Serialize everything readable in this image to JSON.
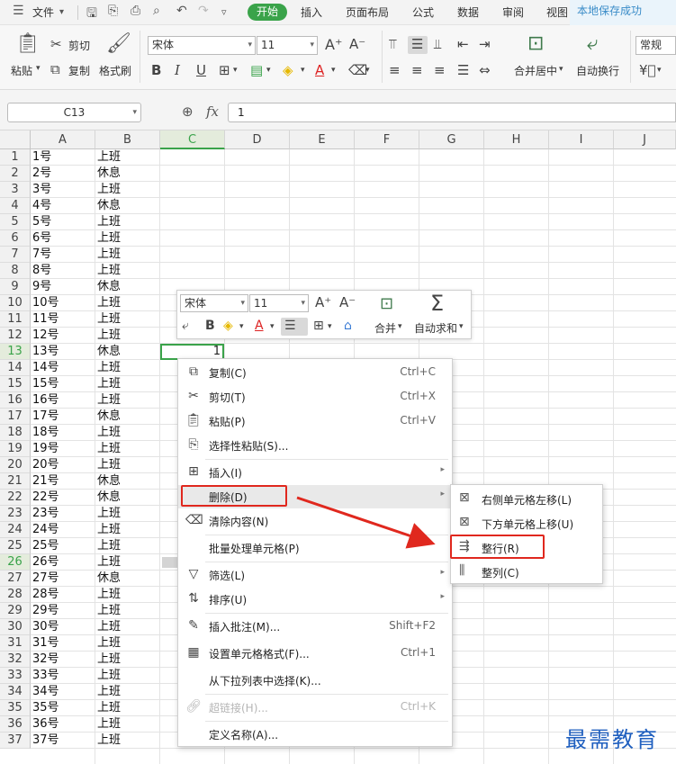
{
  "menubar": {
    "file": "文件",
    "start": "开始",
    "tabs": [
      "插入",
      "页面布局",
      "公式",
      "数据",
      "审阅",
      "视图"
    ],
    "save_status": "本地保存成功"
  },
  "ribbon": {
    "paste": "粘贴",
    "cut": "剪切",
    "copy": "复制",
    "format_painter": "格式刷",
    "font_name": "宋体",
    "font_size": "11",
    "merge_center": "合并居中",
    "wrap_text": "自动换行",
    "number_format": "常规"
  },
  "formula_bar": {
    "name_box": "C13",
    "fx": "fx",
    "value": "1"
  },
  "columns": [
    "A",
    "B",
    "C",
    "D",
    "E",
    "F",
    "G",
    "H",
    "I",
    "J"
  ],
  "rows": [
    {
      "n": "1",
      "a": "1号",
      "b": "上班"
    },
    {
      "n": "2",
      "a": "2号",
      "b": "休息"
    },
    {
      "n": "3",
      "a": "3号",
      "b": "上班"
    },
    {
      "n": "4",
      "a": "4号",
      "b": "休息"
    },
    {
      "n": "5",
      "a": "5号",
      "b": "上班"
    },
    {
      "n": "6",
      "a": "6号",
      "b": "上班"
    },
    {
      "n": "7",
      "a": "7号",
      "b": "上班"
    },
    {
      "n": "8",
      "a": "8号",
      "b": "上班"
    },
    {
      "n": "9",
      "a": "9号",
      "b": "休息"
    },
    {
      "n": "10",
      "a": "10号",
      "b": "上班"
    },
    {
      "n": "11",
      "a": "11号",
      "b": "上班"
    },
    {
      "n": "12",
      "a": "12号",
      "b": "上班"
    },
    {
      "n": "13",
      "a": "13号",
      "b": "休息"
    },
    {
      "n": "14",
      "a": "14号",
      "b": "上班"
    },
    {
      "n": "15",
      "a": "15号",
      "b": "上班"
    },
    {
      "n": "16",
      "a": "16号",
      "b": "上班"
    },
    {
      "n": "17",
      "a": "17号",
      "b": "休息"
    },
    {
      "n": "18",
      "a": "18号",
      "b": "上班"
    },
    {
      "n": "19",
      "a": "19号",
      "b": "上班"
    },
    {
      "n": "20",
      "a": "20号",
      "b": "上班"
    },
    {
      "n": "21",
      "a": "21号",
      "b": "休息"
    },
    {
      "n": "22",
      "a": "22号",
      "b": "休息"
    },
    {
      "n": "23",
      "a": "23号",
      "b": "上班"
    },
    {
      "n": "24",
      "a": "24号",
      "b": "上班"
    },
    {
      "n": "25",
      "a": "25号",
      "b": "上班"
    },
    {
      "n": "26",
      "a": "26号",
      "b": "上班"
    },
    {
      "n": "27",
      "a": "27号",
      "b": "休息"
    },
    {
      "n": "28",
      "a": "28号",
      "b": "上班"
    },
    {
      "n": "29",
      "a": "29号",
      "b": "上班"
    },
    {
      "n": "30",
      "a": "30号",
      "b": "上班"
    },
    {
      "n": "31",
      "a": "31号",
      "b": "上班"
    },
    {
      "n": "32",
      "a": "32号",
      "b": "上班"
    },
    {
      "n": "33",
      "a": "33号",
      "b": "上班"
    },
    {
      "n": "34",
      "a": "34号",
      "b": "上班"
    },
    {
      "n": "35",
      "a": "35号",
      "b": "上班"
    },
    {
      "n": "36",
      "a": "36号",
      "b": "上班"
    },
    {
      "n": "37",
      "a": "37号",
      "b": "上班"
    }
  ],
  "active_cell_value": "1",
  "minibar": {
    "font_name": "宋体",
    "font_size": "11",
    "merge": "合并",
    "autosum": "自动求和"
  },
  "context_menu": {
    "items": [
      {
        "label": "复制(C)",
        "shortcut": "Ctrl+C",
        "icon": "copy-icon"
      },
      {
        "label": "剪切(T)",
        "shortcut": "Ctrl+X",
        "icon": "scissors-icon"
      },
      {
        "label": "粘贴(P)",
        "shortcut": "Ctrl+V",
        "icon": "paste-icon"
      },
      {
        "label": "选择性粘贴(S)...",
        "shortcut": "",
        "icon": "paste-special-icon"
      },
      {
        "label": "插入(I)",
        "shortcut": "",
        "icon": "insert-icon"
      },
      {
        "label": "删除(D)",
        "shortcut": "",
        "icon": ""
      },
      {
        "label": "清除内容(N)",
        "shortcut": "",
        "icon": "eraser-icon"
      },
      {
        "label": "批量处理单元格(P)",
        "shortcut": "",
        "icon": ""
      },
      {
        "label": "筛选(L)",
        "shortcut": "",
        "icon": "filter-icon"
      },
      {
        "label": "排序(U)",
        "shortcut": "",
        "icon": "sort-icon"
      },
      {
        "label": "插入批注(M)...",
        "shortcut": "Shift+F2",
        "icon": "comment-icon"
      },
      {
        "label": "设置单元格格式(F)...",
        "shortcut": "Ctrl+1",
        "icon": "format-cells-icon"
      },
      {
        "label": "从下拉列表中选择(K)...",
        "shortcut": "",
        "icon": ""
      },
      {
        "label": "超链接(H)...",
        "shortcut": "Ctrl+K",
        "icon": "link-icon"
      },
      {
        "label": "定义名称(A)...",
        "shortcut": "",
        "icon": ""
      }
    ]
  },
  "submenu": {
    "items": [
      {
        "label": "右侧单元格左移(L)",
        "icon": "shift-left-icon"
      },
      {
        "label": "下方单元格上移(U)",
        "icon": "shift-up-icon"
      },
      {
        "label": "整行(R)",
        "icon": "delete-row-icon"
      },
      {
        "label": "整列(C)",
        "icon": "delete-column-icon"
      }
    ]
  },
  "watermark": "最需教育",
  "colors": {
    "accent_green": "#3aa34a",
    "highlight_red": "#e0281e",
    "watermark_blue": "#1f5fbf"
  }
}
